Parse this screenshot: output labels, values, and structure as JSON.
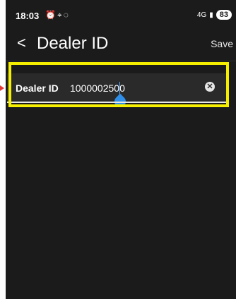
{
  "status_bar": {
    "time": "18:03",
    "notification_icons": [
      "alarm-icon",
      "location-icon",
      "whatsapp-icon"
    ],
    "network": "4G",
    "battery": "83"
  },
  "app_bar": {
    "back_label": "<",
    "title": "Dealer ID",
    "save_label": "Save"
  },
  "form": {
    "dealer_field": {
      "label": "Dealer ID",
      "value": "1000002500",
      "clear_icon": "clear-icon"
    }
  },
  "colors": {
    "screen_bg": "#1b1b1b",
    "highlight": "#f6f000",
    "cursor": "#2f8fe8",
    "pointer": "#e53935"
  }
}
